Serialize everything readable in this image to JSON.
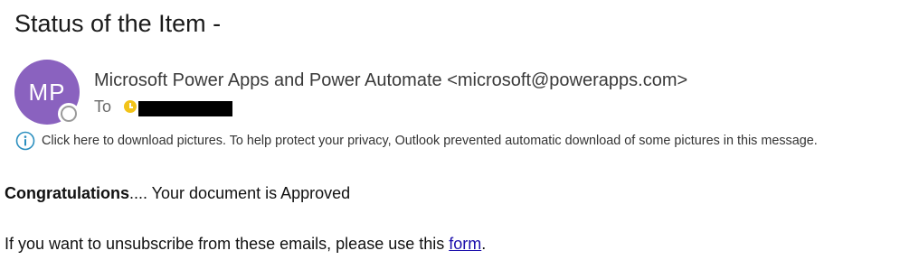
{
  "email": {
    "subject": "Status of the Item -",
    "sender": {
      "initials": "MP",
      "avatar_color": "#8a62bf",
      "display": "Microsoft Power Apps and Power Automate <microsoft@powerapps.com>"
    },
    "to_label": "To",
    "info_bar": {
      "icon": "info-icon",
      "text": "Click here to download pictures. To help protect your privacy, Outlook prevented automatic download of some pictures in this message."
    },
    "body": {
      "line1_bold": "Congratulations",
      "line1_rest": ".... Your document is Approved",
      "line2_prefix": "If you want to unsubscribe from these emails, please use this ",
      "line2_link": "form",
      "line2_suffix": "."
    }
  },
  "colors": {
    "link": "#1a0dab",
    "info_icon": "#2b8fbf",
    "recipient_status": "#f2c318"
  }
}
